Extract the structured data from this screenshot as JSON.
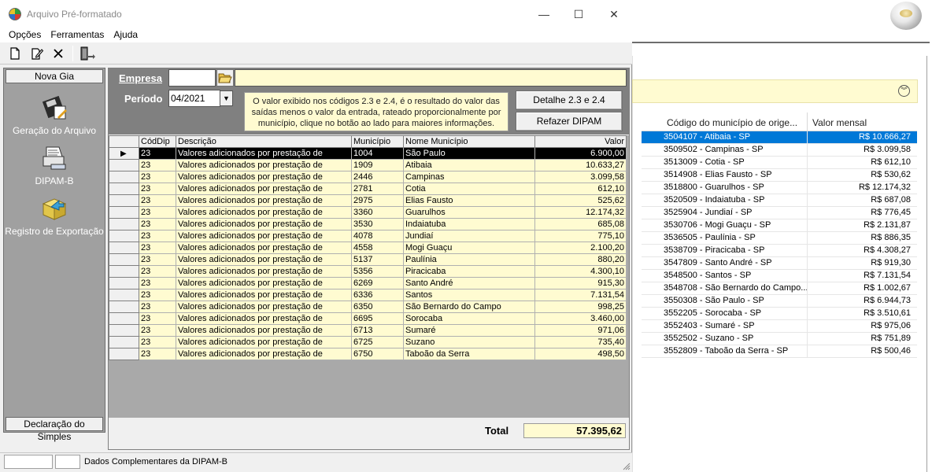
{
  "window": {
    "title": "Arquivo Pré-formatado",
    "minimize": "—",
    "maximize": "☐",
    "close": "✕"
  },
  "menu": [
    "Opções",
    "Ferramentas",
    "Ajuda"
  ],
  "toolbar": {
    "icons": [
      "new-file-icon",
      "edit-file-icon",
      "delete-icon",
      "exit-icon"
    ]
  },
  "sidebar": {
    "top_button": "Nova Gia",
    "items": [
      {
        "label": "Geração do Arquivo",
        "icon": "disk-file-icon"
      },
      {
        "label": "DIPAM-B",
        "icon": "printer-sheet-icon"
      },
      {
        "label": "Registro de Exportação",
        "icon": "export-box-icon"
      }
    ],
    "bottom_button": "Declaração do Simples"
  },
  "form": {
    "empresa_label": "Empresa",
    "empresa_value": "",
    "empresa_name": "",
    "periodo_label": "Período",
    "periodo_value": "04/2021",
    "info_text": "O valor exibido nos códigos 2.3 e 2.4, é o resultado do valor das saídas menos o valor da entrada, rateado proporcionalmente por município, clique no botão ao lado para maiores informações.",
    "btn_detalhe": "Detalhe 2.3 e 2.4",
    "btn_refazer": "Refazer DIPAM"
  },
  "grid": {
    "columns": [
      "CódDip",
      "Descrição",
      "Município",
      "Nome Município",
      "Valor"
    ],
    "rows": [
      {
        "cod": "23",
        "desc": "Valores adicionados por prestação de",
        "mun": "1004",
        "nome": "São Paulo",
        "valor": "6.900,00"
      },
      {
        "cod": "23",
        "desc": "Valores adicionados por prestação de",
        "mun": "1909",
        "nome": "Atibaia",
        "valor": "10.633,27"
      },
      {
        "cod": "23",
        "desc": "Valores adicionados por prestação de",
        "mun": "2446",
        "nome": "Campinas",
        "valor": "3.099,58"
      },
      {
        "cod": "23",
        "desc": "Valores adicionados por prestação de",
        "mun": "2781",
        "nome": "Cotia",
        "valor": "612,10"
      },
      {
        "cod": "23",
        "desc": "Valores adicionados por prestação de",
        "mun": "2975",
        "nome": "Elias Fausto",
        "valor": "525,62"
      },
      {
        "cod": "23",
        "desc": "Valores adicionados por prestação de",
        "mun": "3360",
        "nome": "Guarulhos",
        "valor": "12.174,32"
      },
      {
        "cod": "23",
        "desc": "Valores adicionados por prestação de",
        "mun": "3530",
        "nome": "Indaiatuba",
        "valor": "685,08"
      },
      {
        "cod": "23",
        "desc": "Valores adicionados por prestação de",
        "mun": "4078",
        "nome": "Jundiaí",
        "valor": "775,10"
      },
      {
        "cod": "23",
        "desc": "Valores adicionados por prestação de",
        "mun": "4558",
        "nome": "Mogi Guaçu",
        "valor": "2.100,20"
      },
      {
        "cod": "23",
        "desc": "Valores adicionados por prestação de",
        "mun": "5137",
        "nome": "Paulínia",
        "valor": "880,20"
      },
      {
        "cod": "23",
        "desc": "Valores adicionados por prestação de",
        "mun": "5356",
        "nome": "Piracicaba",
        "valor": "4.300,10"
      },
      {
        "cod": "23",
        "desc": "Valores adicionados por prestação de",
        "mun": "6269",
        "nome": "Santo André",
        "valor": "915,30"
      },
      {
        "cod": "23",
        "desc": "Valores adicionados por prestação de",
        "mun": "6336",
        "nome": "Santos",
        "valor": "7.131,54"
      },
      {
        "cod": "23",
        "desc": "Valores adicionados por prestação de",
        "mun": "6350",
        "nome": "São Bernardo do Campo",
        "valor": "998,25"
      },
      {
        "cod": "23",
        "desc": "Valores adicionados por prestação de",
        "mun": "6695",
        "nome": "Sorocaba",
        "valor": "3.460,00"
      },
      {
        "cod": "23",
        "desc": "Valores adicionados por prestação de",
        "mun": "6713",
        "nome": "Sumaré",
        "valor": "971,06"
      },
      {
        "cod": "23",
        "desc": "Valores adicionados por prestação de",
        "mun": "6725",
        "nome": "Suzano",
        "valor": "735,40"
      },
      {
        "cod": "23",
        "desc": "Valores adicionados por prestação de",
        "mun": "6750",
        "nome": "Taboão da Serra",
        "valor": "498,50"
      }
    ]
  },
  "total": {
    "label": "Total",
    "value": "57.395,62"
  },
  "status": {
    "text": "Dados Complementares da DIPAM-B"
  },
  "background_app": {
    "columns": [
      "Código do município de orige...",
      "Valor mensal"
    ],
    "rows": [
      {
        "mun": "3504107 - Atibaia - SP",
        "valor": "R$ 10.666,27"
      },
      {
        "mun": "3509502 - Campinas - SP",
        "valor": "R$ 3.099,58"
      },
      {
        "mun": "3513009 - Cotia - SP",
        "valor": "R$ 612,10"
      },
      {
        "mun": "3514908 - Elias Fausto - SP",
        "valor": "R$ 530,62"
      },
      {
        "mun": "3518800 - Guarulhos - SP",
        "valor": "R$ 12.174,32"
      },
      {
        "mun": "3520509 - Indaiatuba - SP",
        "valor": "R$ 687,08"
      },
      {
        "mun": "3525904 - Jundiaí - SP",
        "valor": "R$ 776,45"
      },
      {
        "mun": "3530706 - Mogi Guaçu - SP",
        "valor": "R$ 2.131,87"
      },
      {
        "mun": "3536505 - Paulínia - SP",
        "valor": "R$ 886,35"
      },
      {
        "mun": "3538709 - Piracicaba - SP",
        "valor": "R$ 4.308,27"
      },
      {
        "mun": "3547809 - Santo André - SP",
        "valor": "R$ 919,30"
      },
      {
        "mun": "3548500 - Santos - SP",
        "valor": "R$ 7.131,54"
      },
      {
        "mun": "3548708 - São Bernardo do Campo...",
        "valor": "R$ 1.002,67"
      },
      {
        "mun": "3550308 - São Paulo - SP",
        "valor": "R$ 6.944,73"
      },
      {
        "mun": "3552205 - Sorocaba - SP",
        "valor": "R$ 3.510,61"
      },
      {
        "mun": "3552403 - Sumaré - SP",
        "valor": "R$ 975,06"
      },
      {
        "mun": "3552502 - Suzano - SP",
        "valor": "R$ 751,89"
      },
      {
        "mun": "3552809 - Taboão da Serra - SP",
        "valor": "R$ 500,46"
      }
    ]
  }
}
